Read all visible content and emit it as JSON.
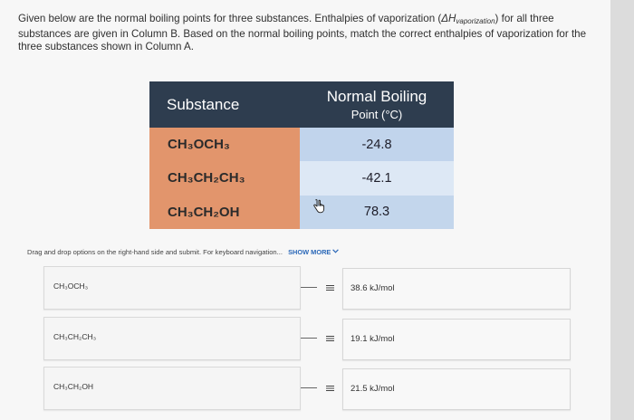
{
  "question": {
    "text_before": "Given below are the normal boiling points for three substances. Enthalpies of vaporization (",
    "delta_h": "ΔH",
    "delta_h_sub": "vaporization",
    "text_after": ") for all three substances are given in Column B. Based on the normal boiling points, match the correct enthalpies of vaporization for the three substances shown in Column A."
  },
  "table": {
    "header_substance": "Substance",
    "header_bp_line1": "Normal Boiling",
    "header_bp_line2": "Point (°C)",
    "rows": [
      {
        "substance": "CH₃OCH₃",
        "bp": "-24.8"
      },
      {
        "substance": "CH₃CH₂CH₃",
        "bp": "-42.1"
      },
      {
        "substance": "CH₃CH₂OH",
        "bp": "78.3"
      }
    ]
  },
  "instructions": {
    "text": "Drag and drop options on the right-hand side and submit. For keyboard navigation...",
    "show_more": "SHOW MORE",
    "show_more_icon": "chevron-down-icon"
  },
  "matching": {
    "column_a": [
      "CH₃OCH₃",
      "CH₃CH₂CH₃",
      "CH₃CH₂OH"
    ],
    "column_b": [
      "38.6 kJ/mol",
      "19.1 kJ/mol",
      "21.5 kJ/mol"
    ],
    "handle_icon": "drag-handle-icon"
  }
}
